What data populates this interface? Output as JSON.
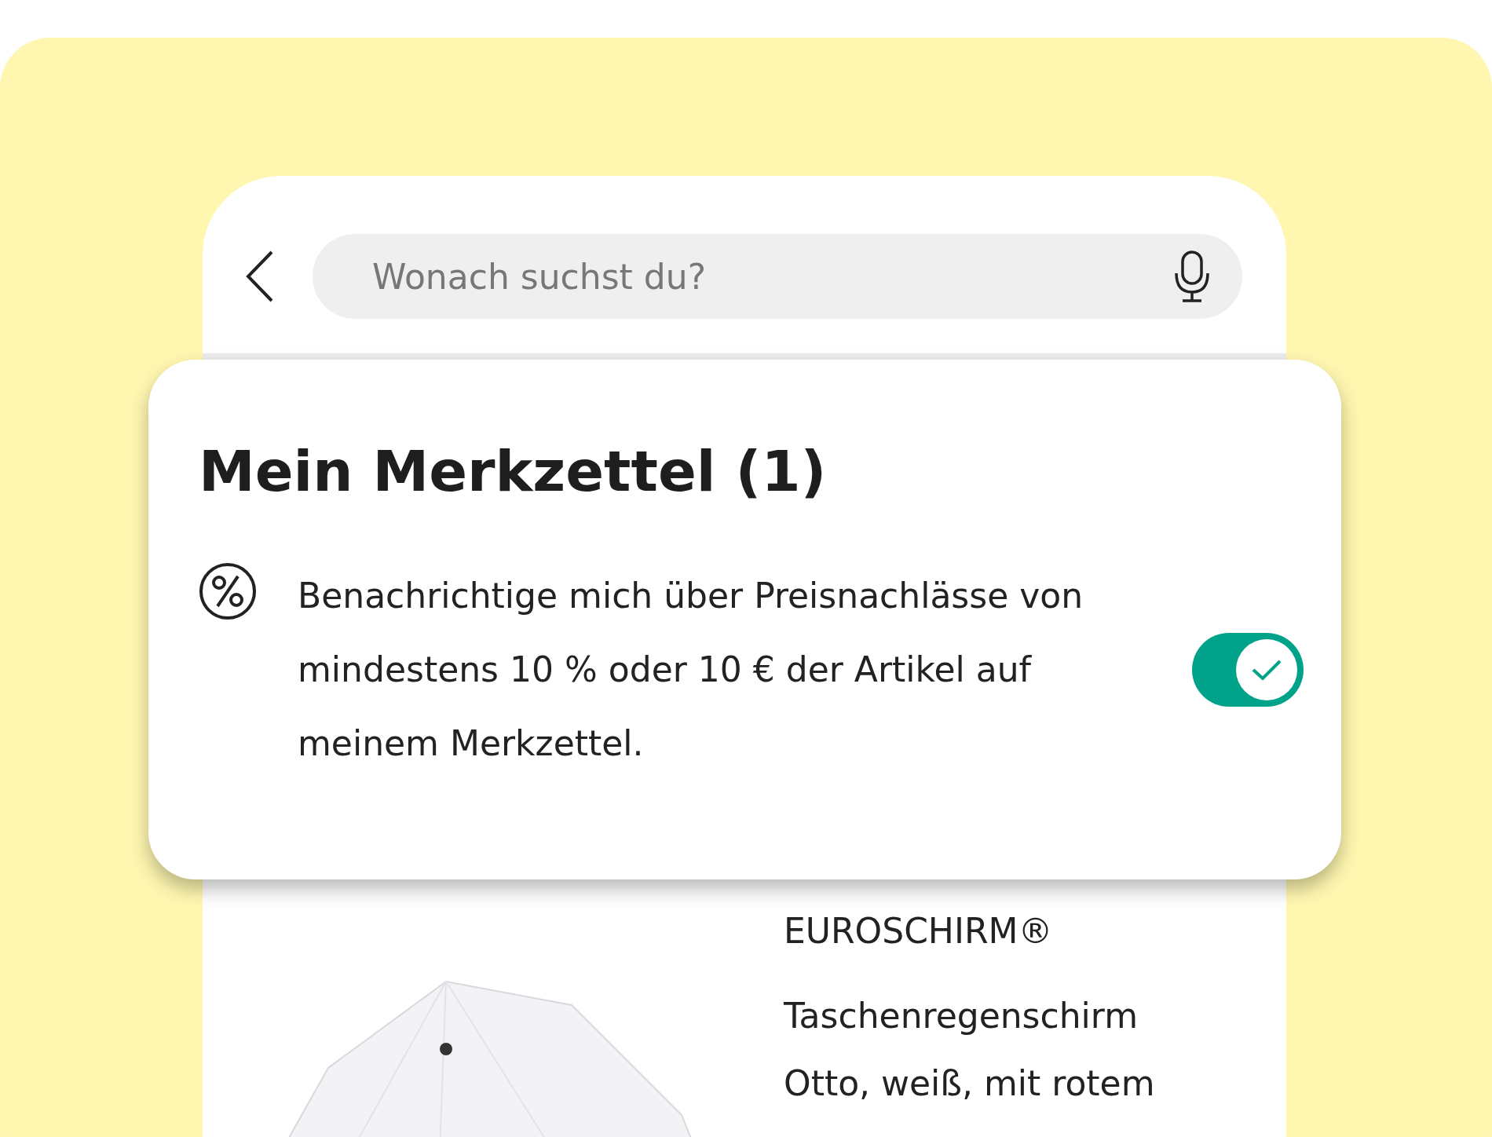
{
  "search": {
    "placeholder": "Wonach suchst du?"
  },
  "wishlist": {
    "title": "Mein Merkzettel (1)",
    "notification": {
      "text": "Benachrichtige mich über Preisnachlässe von mindestens 10 % oder 10 € der Artikel auf meinem Merkzettel.",
      "on": true
    }
  },
  "product": {
    "brand": "EUROSCHIRM®",
    "name_lines": [
      "Taschenregenschirm",
      "Otto, weiß, mit rotem"
    ]
  }
}
